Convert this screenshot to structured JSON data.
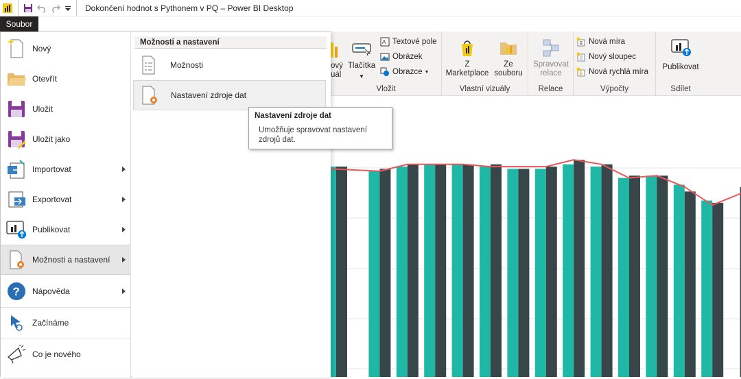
{
  "window": {
    "title": "Dokončení hodnot s Pythonem v PQ – Power BI Desktop"
  },
  "file_tab": {
    "label": "Soubor"
  },
  "file_menu": {
    "items": [
      {
        "label": "Nový",
        "icon": "new-file-icon",
        "submenu": false
      },
      {
        "label": "Otevřít",
        "icon": "folder-open-icon",
        "submenu": false
      },
      {
        "label": "Uložit",
        "icon": "save-icon",
        "submenu": false
      },
      {
        "label": "Uložit jako",
        "icon": "save-as-icon",
        "submenu": false
      },
      {
        "label": "Importovat",
        "icon": "import-icon",
        "submenu": true
      },
      {
        "label": "Exportovat",
        "icon": "export-icon",
        "submenu": true
      },
      {
        "label": "Publikovat",
        "icon": "publish-icon",
        "submenu": true
      },
      {
        "label": "Možnosti a nastavení",
        "icon": "options-settings-icon",
        "submenu": true,
        "selected": true
      },
      {
        "label": "Nápověda",
        "icon": "help-icon",
        "submenu": true
      },
      {
        "label": "Začínáme",
        "icon": "getting-started-icon",
        "submenu": false
      },
      {
        "label": "Co je nového",
        "icon": "whats-new-icon",
        "submenu": false
      }
    ]
  },
  "submenu": {
    "header": "Možnosti a nastavení",
    "items": [
      {
        "label": "Možnosti",
        "icon": "options-page-icon"
      },
      {
        "label": "Nastavení zdroje dat",
        "icon": "data-source-settings-icon"
      }
    ]
  },
  "tooltip": {
    "title": "Nastavení zdroje dat",
    "body": "Umožňuje spravovat nastavení zdrojů dat."
  },
  "ribbon": {
    "insert_group": {
      "label": "Vložit",
      "new_visual_partial": [
        "ový",
        "uál"
      ],
      "buttons_label": "Tlačítka",
      "text_box": "Textové pole",
      "image": "Obrázek",
      "shapes": "Obrazce"
    },
    "custom_visuals_group": {
      "label": "Vlastní vizuály",
      "marketplace": [
        "Z",
        "Marketplace"
      ],
      "from_file": [
        "Ze",
        "souboru"
      ]
    },
    "relationships_group": {
      "label": "Relace",
      "manage": [
        "Spravovat",
        "relace"
      ]
    },
    "calculations_group": {
      "label": "Výpočty",
      "new_measure": "Nová míra",
      "new_column": "Nový sloupec",
      "new_quick_measure": "Nová rychlá míra"
    },
    "share_group": {
      "label": "Sdílet",
      "publish": "Publikovat"
    }
  },
  "colors": {
    "teal_bar": "#1fb8a6",
    "dark_bar": "#374649",
    "line": "#e8595d",
    "menu_selected": "#e6e6e6",
    "title_bar_dark": "#252423"
  },
  "chart_data": {
    "type": "bar",
    "series": [
      {
        "values": [
          0.93,
          0.91,
          0.93,
          0.94,
          0.94,
          0.93,
          0.92,
          0.92,
          0.94,
          0.93,
          0.88,
          0.89,
          0.85,
          0.78
        ]
      },
      {
        "values": [
          0.93,
          0.92,
          0.94,
          0.94,
          0.94,
          0.94,
          0.92,
          0.93,
          0.96,
          0.94,
          0.89,
          0.89,
          0.82,
          0.77,
          0.84
        ]
      }
    ],
    "line_values": [
      0.92,
      0.91,
      0.94,
      0.94,
      0.94,
      0.93,
      0.93,
      0.93,
      0.96,
      0.94,
      0.88,
      0.89,
      0.84,
      0.76,
      0.81
    ]
  }
}
